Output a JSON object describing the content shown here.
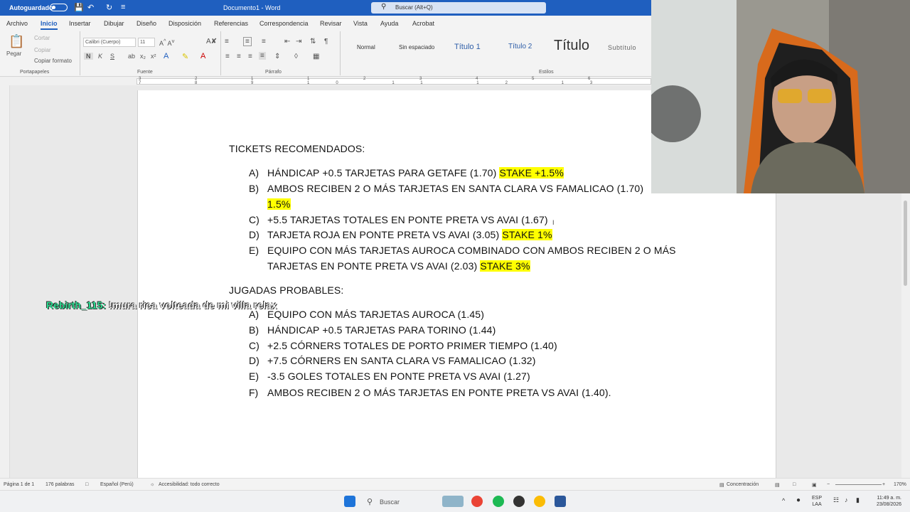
{
  "titlebar": {
    "autosave_label": "Autoguardado",
    "document_title": "Documento1 - Word",
    "search_placeholder": "Buscar (Alt+Q)"
  },
  "ribbon": {
    "tabs": [
      "Archivo",
      "Inicio",
      "Insertar",
      "Dibujar",
      "Diseño",
      "Disposición",
      "Referencias",
      "Correspondencia",
      "Revisar",
      "Vista",
      "Ayuda",
      "Acrobat"
    ],
    "active_tab": "Inicio",
    "clipboard": {
      "paste": "Pegar",
      "cut": "Cortar",
      "copy": "Copiar",
      "format_painter": "Copiar formato",
      "group": "Portapapeles"
    },
    "font": {
      "name": "Calibri (Cuerpo)",
      "size": "11",
      "group": "Fuente"
    },
    "paragraph": {
      "group": "Párrafo"
    },
    "styles": {
      "items": [
        "Normal",
        "Sin espaciado",
        "Título 1",
        "Título 2",
        "Título",
        "Subtítulo"
      ],
      "group": "Estilos"
    }
  },
  "ruler": {
    "numbers": "3 2 1 1 2 3 4 5 6 7 8 9 10 11 12 13"
  },
  "document": {
    "section1_title": "TICKETS RECOMENDADOS:",
    "section1_items": [
      {
        "letter": "A)",
        "text": "HÁNDICAP +0.5 TARJETAS PARA GETAFE (1.70) ",
        "stake": "STAKE +1.5%"
      },
      {
        "letter": "B)",
        "text": "AMBOS RECIBEN 2 O MÁS TARJETAS EN SANTA CLARA VS FAMALICAO (1.70)",
        "stake": "1.5%"
      },
      {
        "letter": "C)",
        "text": "+5.5 TARJETAS TOTALES EN PONTE PRETA VS AVAI (1.67)",
        "stake": ""
      },
      {
        "letter": "D)",
        "text": "TARJETA ROJA EN PONTE PRETA VS AVAI (3.05) ",
        "stake": "STAKE 1%"
      },
      {
        "letter": "E)",
        "text": "EQUIPO CON MÁS TARJETAS AUROCA COMBINADO CON AMBOS RECIBEN 2 O MÁS",
        "text2": "TARJETAS EN PONTE PRETA VS AVAI (2.03) ",
        "stake": "STAKE 3%"
      }
    ],
    "section2_title": "JUGADAS PROBABLES:",
    "section2_items": [
      {
        "letter": "A)",
        "text": "EQUIPO CON MÁS TARJETAS AUROCA (1.45)"
      },
      {
        "letter": "B)",
        "text": "HÁNDICAP +0.5 TARJETAS PARA TORINO (1.44)"
      },
      {
        "letter": "C)",
        "text": "+2.5 CÓRNERS TOTALES DE PORTO PRIMER TIEMPO (1.40)"
      },
      {
        "letter": "D)",
        "text": "+7.5 CÓRNERS EN SANTA CLARA VS FAMALICAO (1.32)"
      },
      {
        "letter": "E)",
        "text": "-3.5 GOLES TOTALES EN PONTE PRETA VS AVAI (1.27)"
      },
      {
        "letter": "F)",
        "text": "AMBOS RECIBEN 2 O MÁS TARJETAS EN PONTE PRETA VS AVAI (1.40)."
      }
    ]
  },
  "chat_overlay": {
    "user": "Rebirth_115:",
    "message": " !mura rica volteada de mi villa relax"
  },
  "statusbar": {
    "page": "Página 1 de 1",
    "words": "176 palabras",
    "language": "Español (Perú)",
    "accessibility": "Accesibilidad: todo correcto",
    "focus": "Concentración",
    "zoom": "170%"
  },
  "taskbar": {
    "search_label": "Buscar",
    "lang1": "ESP",
    "lang2": "LAA",
    "time": "11:49 a. m.",
    "date": "23/08/2026"
  },
  "colors": {
    "titlebar": "#1f5fbf",
    "highlight": "#ffff00",
    "chat_user": "#2bd98f"
  }
}
